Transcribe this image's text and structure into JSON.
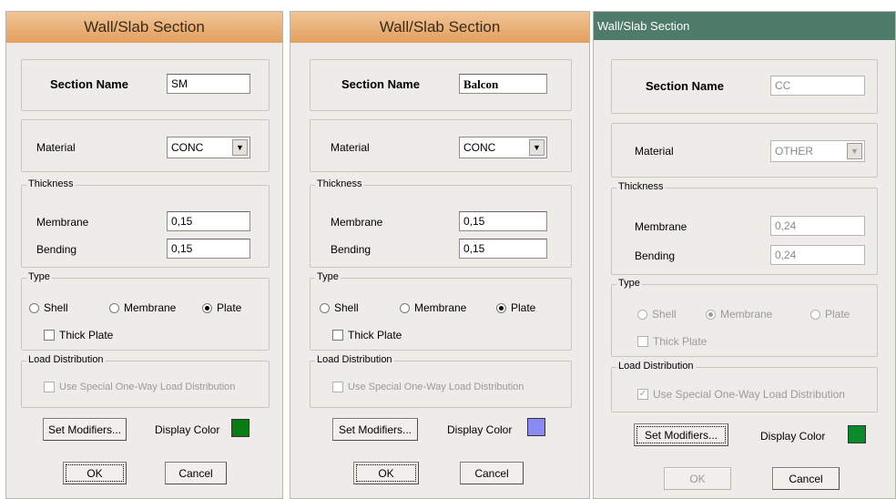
{
  "dialogs": [
    {
      "title": "Wall/Slab Section",
      "section_name_label": "Section Name",
      "section_name_value": "SM",
      "material_label": "Material",
      "material_value": "CONC",
      "thickness_label": "Thickness",
      "membrane_label": "Membrane",
      "membrane_value": "0,15",
      "bending_label": "Bending",
      "bending_value": "0,15",
      "type_label": "Type",
      "shell_label": "Shell",
      "membrane_option_label": "Membrane",
      "plate_label": "Plate",
      "selected_type": "Plate",
      "thick_plate_label": "Thick Plate",
      "load_distribution_label": "Load Distribution",
      "one_way_label": "Use Special One-Way Load Distribution",
      "set_modifiers_label": "Set Modifiers...",
      "display_color_label": "Display Color",
      "display_color": "#0a7a12",
      "ok_label": "OK",
      "cancel_label": "Cancel"
    },
    {
      "title": "Wall/Slab Section",
      "section_name_label": "Section Name",
      "section_name_value": "Balcon",
      "material_label": "Material",
      "material_value": "CONC",
      "thickness_label": "Thickness",
      "membrane_label": "Membrane",
      "membrane_value": "0,15",
      "bending_label": "Bending",
      "bending_value": "0,15",
      "type_label": "Type",
      "shell_label": "Shell",
      "membrane_option_label": "Membrane",
      "plate_label": "Plate",
      "selected_type": "Plate",
      "thick_plate_label": "Thick Plate",
      "load_distribution_label": "Load Distribution",
      "one_way_label": "Use Special One-Way Load Distribution",
      "set_modifiers_label": "Set Modifiers...",
      "display_color_label": "Display Color",
      "display_color": "#8a8af5",
      "ok_label": "OK",
      "cancel_label": "Cancel"
    },
    {
      "title": "Wall/Slab Section",
      "section_name_label": "Section Name",
      "section_name_value": "CC",
      "material_label": "Material",
      "material_value": "OTHER",
      "thickness_label": "Thickness",
      "membrane_label": "Membrane",
      "membrane_value": "0,24",
      "bending_label": "Bending",
      "bending_value": "0,24",
      "type_label": "Type",
      "shell_label": "Shell",
      "membrane_option_label": "Membrane",
      "plate_label": "Plate",
      "selected_type": "Membrane",
      "thick_plate_label": "Thick Plate",
      "load_distribution_label": "Load Distribution",
      "one_way_label": "Use Special One-Way Load Distribution",
      "one_way_checked": true,
      "set_modifiers_label": "Set Modifiers...",
      "display_color_label": "Display Color",
      "display_color": "#0a8a2a",
      "ok_label": "OK",
      "cancel_label": "Cancel"
    }
  ],
  "icons": {
    "combo_arrow": "chevron-down-icon",
    "check_mark": "checkmark-icon"
  }
}
